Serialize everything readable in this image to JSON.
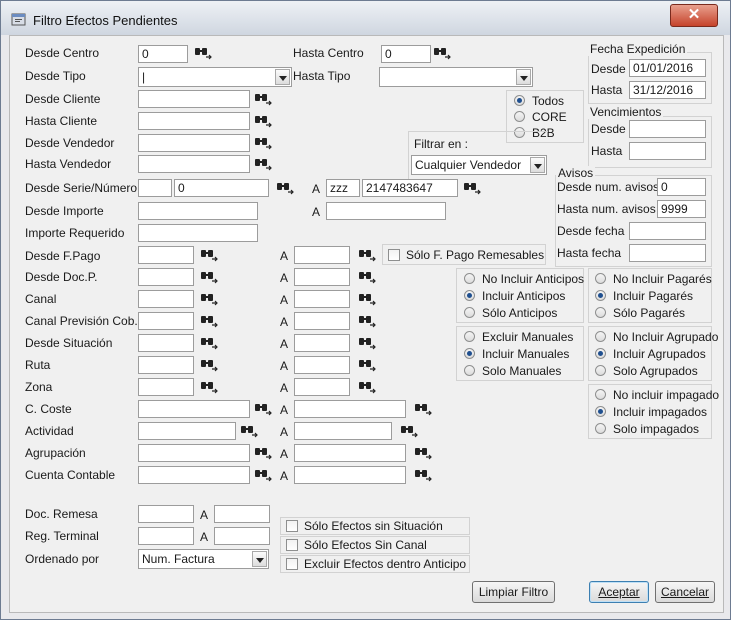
{
  "window": {
    "title": "Filtro Efectos Pendientes",
    "close_glyph": "✕"
  },
  "labels": {
    "desde_centro": "Desde Centro",
    "hasta_centro": "Hasta Centro",
    "desde_tipo": "Desde Tipo",
    "hasta_tipo": "Hasta Tipo",
    "desde_cliente": "Desde Cliente",
    "hasta_cliente": "Hasta Cliente",
    "desde_vendedor": "Desde Vendedor",
    "hasta_vendedor": "Hasta Vendedor",
    "desde_serie": "Desde Serie/Número",
    "desde_importe": "Desde Importe",
    "importe_requerido": "Importe Requerido",
    "desde_fpago": "Desde F.Pago",
    "desde_docp": "Desde Doc.P.",
    "canal": "Canal",
    "canal_prevision": "Canal Previsión Cob.",
    "desde_situacion": "Desde Situación",
    "ruta": "Ruta",
    "zona": "Zona",
    "c_coste": "C. Coste",
    "actividad": "Actividad",
    "agrupacion": "Agrupación",
    "cuenta_contable": "Cuenta Contable",
    "doc_remesa": "Doc. Remesa",
    "reg_terminal": "Reg. Terminal",
    "ordenado_por": "Ordenado por",
    "a": "A",
    "filtrar_en": "Filtrar en :"
  },
  "values": {
    "desde_centro": "0",
    "hasta_centro": "0",
    "desde_tipo": "|",
    "hasta_tipo": "",
    "serie_desde": "",
    "numero_desde": "0",
    "serie_hasta": "zzz",
    "numero_hasta": "2147483647",
    "filtrar_en": "Cualquier Vendedor",
    "ordenado_por": "Num. Factura"
  },
  "fecha_expedicion": {
    "title": "Fecha Expedición",
    "desde_label": "Desde",
    "hasta_label": "Hasta",
    "desde": "01/01/2016",
    "hasta": "31/12/2016"
  },
  "vencimientos": {
    "title": "Vencimientos",
    "desde_label": "Desde",
    "hasta_label": "Hasta",
    "desde": "",
    "hasta": ""
  },
  "avisos": {
    "title": "Avisos",
    "desde_num_label": "Desde num. avisos",
    "hasta_num_label": "Hasta num. avisos",
    "desde_fecha_label": "Desde fecha",
    "hasta_fecha_label": "Hasta fecha",
    "desde_num": "0",
    "hasta_num": "9999",
    "desde_fecha": "",
    "hasta_fecha": ""
  },
  "radio_groups": {
    "tipo_cliente": [
      "Todos",
      "CORE",
      "B2B"
    ],
    "anticipos": [
      "No Incluir Anticipos",
      "Incluir Anticipos",
      "Sólo Anticipos"
    ],
    "pagares": [
      "No Incluir Pagarés",
      "Incluir Pagarés",
      "Sólo Pagarés"
    ],
    "manuales": [
      "Excluir Manuales",
      "Incluir Manuales",
      "Solo Manuales"
    ],
    "agrupados": [
      "No Incluir Agrupado",
      "Incluir Agrupados",
      "Solo Agrupados"
    ],
    "impagados": [
      "No incluir impagado",
      "Incluir impagados",
      "Solo impagados"
    ]
  },
  "checkboxes": {
    "solo_fpago_remesables": "Sólo F. Pago Remesables",
    "solo_sin_situacion": "Sólo Efectos sin Situación",
    "solo_sin_canal": "Sólo Efectos Sin Canal",
    "excluir_anticipo": "Excluir Efectos dentro Anticipo"
  },
  "buttons": {
    "limpiar": "Limpiar Filtro",
    "aceptar": "Aceptar",
    "cancelar": "Cancelar"
  },
  "icons": {
    "search": "binoculars-search-icon",
    "title": "window-app-icon",
    "close": "close-icon"
  },
  "colors": {
    "radio_selected": "#1f4f8f",
    "close_button": "#c5432b",
    "titlebar": "#cfd6e0"
  }
}
